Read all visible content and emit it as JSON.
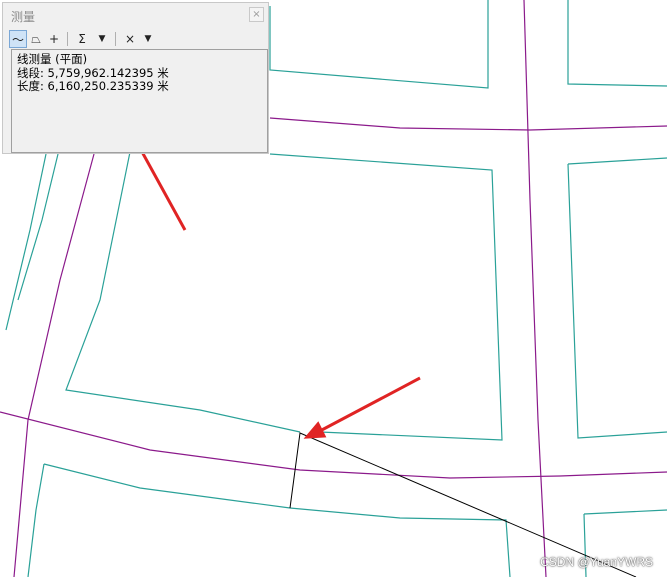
{
  "panel": {
    "title": "测量",
    "close_label": "×",
    "toolbar": {
      "line_icon": "〜",
      "area_icon": "⏢",
      "point_icon": "+",
      "sum_icon": "Σ",
      "clear_icon": "×",
      "dropdown_icon": "▼"
    },
    "results": {
      "heading": "线测量 (平面)",
      "segment": "线段: 5,759,962.142395 米",
      "length": "长度: 6,160,250.235339 米"
    }
  },
  "watermark": "CSDN @YuanYWRS",
  "colors": {
    "teal_boundaries": "#2aa198",
    "purple_centerlines": "#8b1a8b",
    "measure_line": "#000000",
    "arrow": "#e02424"
  }
}
